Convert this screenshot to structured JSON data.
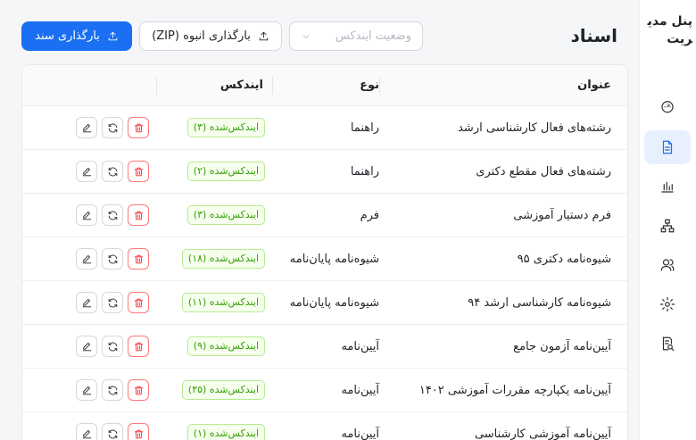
{
  "sidebar": {
    "brand": "پنل مدیریت",
    "items": [
      {
        "name": "dashboard",
        "icon": "gauge-icon",
        "active": false
      },
      {
        "name": "documents",
        "icon": "document-icon",
        "active": true
      },
      {
        "name": "analytics",
        "icon": "bar-chart-icon",
        "active": false
      },
      {
        "name": "structure",
        "icon": "hierarchy-icon",
        "active": false
      },
      {
        "name": "users",
        "icon": "users-icon",
        "active": false
      },
      {
        "name": "settings",
        "icon": "gear-icon",
        "active": false
      },
      {
        "name": "logs",
        "icon": "search-document-icon",
        "active": false
      }
    ]
  },
  "header": {
    "title": "اسناد",
    "upload_label": "بارگذاری سند",
    "bulk_upload_label": "بارگذاری انبوه (ZIP)",
    "status_filter_placeholder": "وضعیت ایندکس"
  },
  "table": {
    "columns": {
      "title": "عنوان",
      "type": "نوع",
      "index": "ایندکس"
    },
    "rows": [
      {
        "title": "رشته‌های فعال کارشناسی ارشد",
        "type": "راهنما",
        "index": "ایندکس‌شده (۳)"
      },
      {
        "title": "رشته‌های فعال مقطع دکتری",
        "type": "راهنما",
        "index": "ایندکس‌شده (۲)"
      },
      {
        "title": "فرم دستیار آموزشی",
        "type": "فرم",
        "index": "ایندکس‌شده (۳)"
      },
      {
        "title": "شیوه‌نامه دکتری ۹۵",
        "type": "شیوه‌نامه پایان‌نامه",
        "index": "ایندکس‌شده (۱۸)"
      },
      {
        "title": "شیوه‌نامه کارشناسی ارشد ۹۴",
        "type": "شیوه‌نامه پایان‌نامه",
        "index": "ایندکس‌شده (۱۱)"
      },
      {
        "title": "آیین‌نامه آزمون جامع",
        "type": "آیین‌نامه",
        "index": "ایندکس‌شده (۹)"
      },
      {
        "title": "آیین‌نامه یکپارچه مقررات آموزشی ۱۴۰۲",
        "type": "آیین‌نامه",
        "index": "ایندکس‌شده (۳۵)"
      },
      {
        "title": "آیین‌نامه آموزشی کارشناسی",
        "type": "آیین‌نامه",
        "index": "ایندکس‌شده (۱)"
      }
    ]
  },
  "colors": {
    "primary": "#1a6ff2",
    "success": "#389e0d",
    "danger": "#f5222d"
  }
}
